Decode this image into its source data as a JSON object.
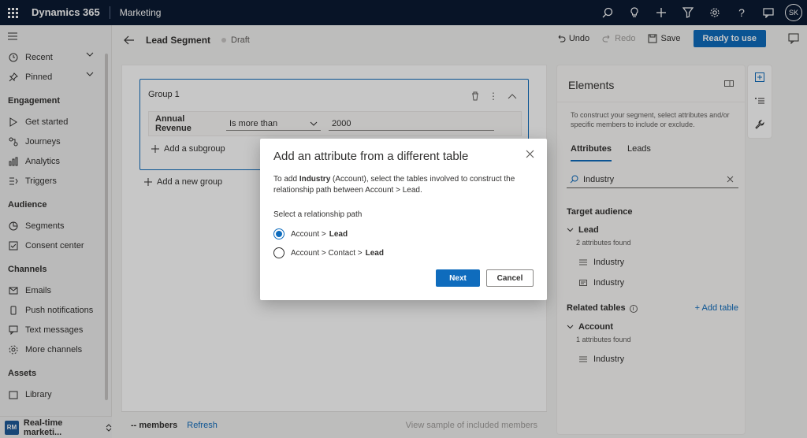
{
  "topbar": {
    "brand": "Dynamics 365",
    "app_name": "Marketing",
    "avatar_initials": "SK",
    "icons": [
      "search-icon",
      "lightbulb-icon",
      "plus-icon",
      "filter-icon",
      "gear-icon",
      "help-icon",
      "chat-icon"
    ]
  },
  "leftnav": {
    "recent": "Recent",
    "pinned": "Pinned",
    "sections": [
      {
        "title": "Engagement",
        "items": [
          "Get started",
          "Journeys",
          "Analytics",
          "Triggers"
        ]
      },
      {
        "title": "Audience",
        "items": [
          "Segments",
          "Consent center"
        ]
      },
      {
        "title": "Channels",
        "items": [
          "Emails",
          "Push notifications",
          "Text messages",
          "More channels"
        ]
      },
      {
        "title": "Assets",
        "items": [
          "Library"
        ]
      }
    ],
    "area": {
      "badge": "RM",
      "label": "Real-time marketi..."
    }
  },
  "cmdbar": {
    "title": "Lead Segment",
    "status": "Draft",
    "undo": "Undo",
    "redo": "Redo",
    "save": "Save",
    "ready": "Ready to use"
  },
  "canvas": {
    "group_title": "Group 1",
    "condition": {
      "attribute": "Annual Revenue",
      "operator": "Is more than",
      "value": "2000"
    },
    "add_subgroup": "Add a subgroup",
    "add_group": "Add a new group",
    "footer": {
      "members": "-- members",
      "refresh": "Refresh",
      "view_sample": "View sample of included members"
    }
  },
  "elements": {
    "title": "Elements",
    "description": "To construct your segment, select attributes and/or specific members to include or exclude.",
    "tabs": [
      "Attributes",
      "Leads"
    ],
    "search_value": "Industry",
    "target_heading": "Target audience",
    "lead": {
      "name": "Lead",
      "count": "2 attributes found",
      "items": [
        "Industry",
        "Industry"
      ]
    },
    "related_heading": "Related tables",
    "add_table": "+ Add table",
    "account": {
      "name": "Account",
      "count": "1 attributes found",
      "items": [
        "Industry"
      ]
    }
  },
  "dialog": {
    "title": "Add an attribute from a different table",
    "body_prefix": "To add ",
    "body_bold": "Industry",
    "body_suffix": " (Account), select the tables involved to construct the relationship path between Account > Lead.",
    "label": "Select a relationship path",
    "options": [
      {
        "prefix": "Account > ",
        "bold": "Lead",
        "checked": true
      },
      {
        "prefix": "Account > Contact > ",
        "bold": "Lead",
        "checked": false
      }
    ],
    "next": "Next",
    "cancel": "Cancel"
  }
}
